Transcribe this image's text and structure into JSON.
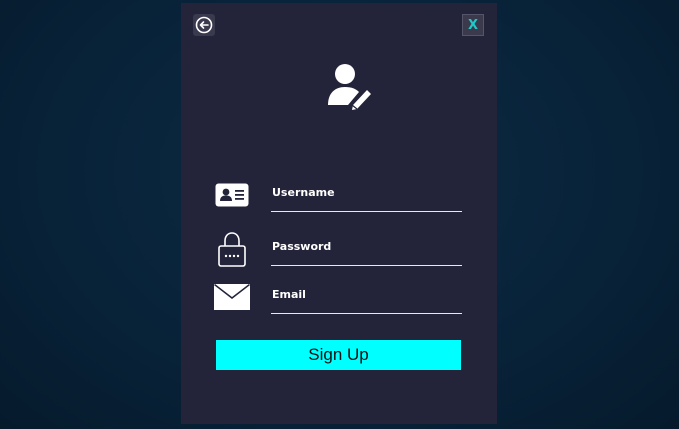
{
  "window": {
    "close_label": "X",
    "back_icon": "back-arrow-icon",
    "avatar_icon": "user-edit-icon"
  },
  "form": {
    "username": {
      "label": "Username",
      "icon": "id-card-icon"
    },
    "password": {
      "label": "Password",
      "icon": "lock-icon"
    },
    "email": {
      "label": "Email",
      "icon": "envelope-icon"
    }
  },
  "actions": {
    "signup_label": "Sign Up"
  },
  "colors": {
    "background": "#082238",
    "panel": "#23233a",
    "accent": "#00ffff",
    "close_text": "#1ec9c9"
  }
}
